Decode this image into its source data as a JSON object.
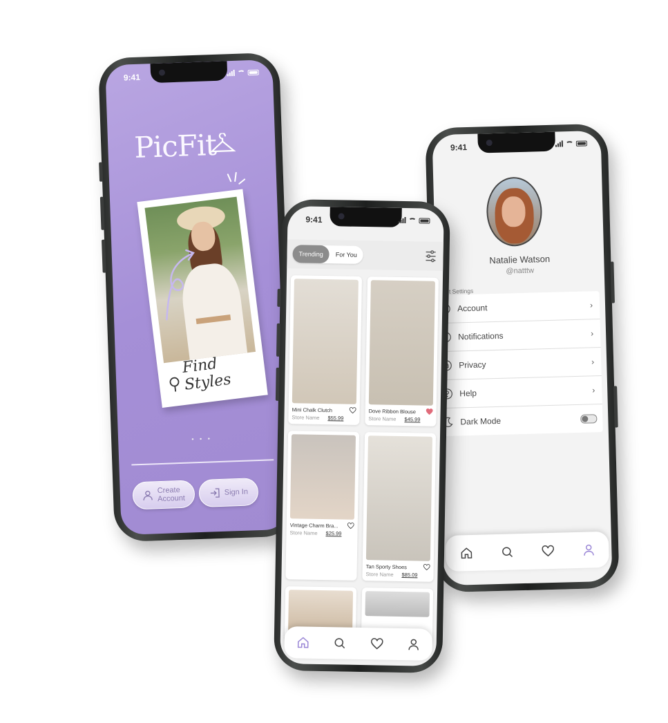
{
  "status": {
    "time": "9:41"
  },
  "onboarding": {
    "logo_text": "PicFit",
    "tagline": "Find Styles",
    "pagination": "• • •",
    "create_account_label": "Create Account",
    "sign_in_label": "Sign In"
  },
  "feed": {
    "tabs": [
      {
        "label": "Trending",
        "active": true
      },
      {
        "label": "For You",
        "active": false
      }
    ],
    "products": [
      {
        "name": "Mini Chalk Clutch",
        "store": "Store Name",
        "price": "$55.99",
        "liked": false
      },
      {
        "name": "Dove Ribbon Blouse",
        "store": "Store Name",
        "price": "$45.99",
        "liked": true
      },
      {
        "name": "Vintage Charm Bra...",
        "store": "Store Name",
        "price": "$25.99",
        "liked": false
      },
      {
        "name": "Tan Sporty Shoes",
        "store": "Store Name",
        "price": "$85.09",
        "liked": false
      }
    ]
  },
  "profile": {
    "name": "Natalie Watson",
    "handle": "@natttw",
    "settings_header": "count Settings",
    "settings": [
      {
        "label": "Account",
        "icon": "user-icon"
      },
      {
        "label": "Notifications",
        "icon": "bell-icon"
      },
      {
        "label": "Privacy",
        "icon": "shield-icon"
      },
      {
        "label": "Help",
        "icon": "help-icon"
      },
      {
        "label": "Dark Mode",
        "icon": "moon-icon"
      }
    ],
    "dark_mode_on": false
  },
  "colors": {
    "brand_purple": "#a893d8",
    "accent_icon": "#9a86d6",
    "heart_liked": "#e06b7a"
  }
}
